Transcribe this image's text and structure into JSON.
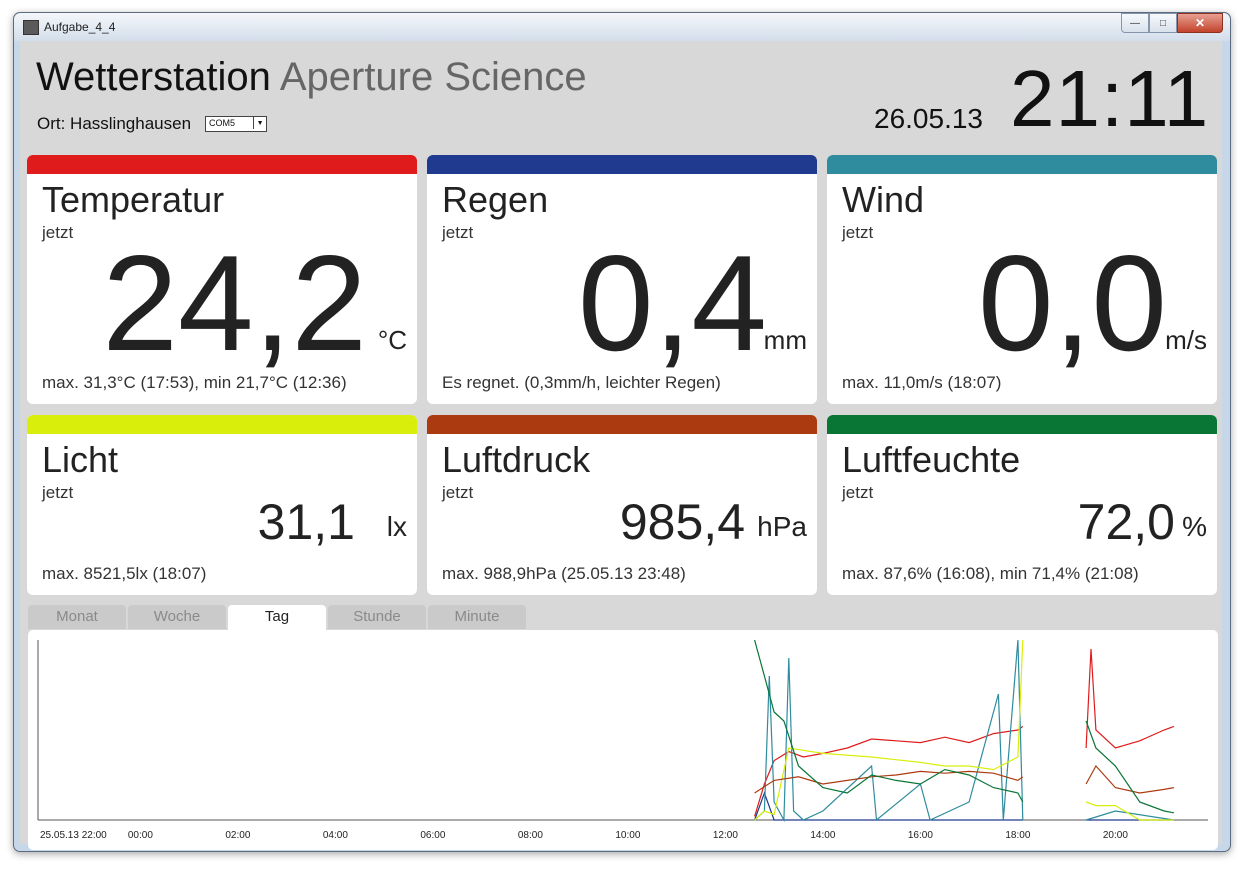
{
  "window": {
    "title": "Aufgabe_4_4"
  },
  "header": {
    "title": "Wetterstation",
    "subtitle": "Aperture Science",
    "location": "Ort: Hasslinghausen",
    "port": "COM5",
    "date": "26.05.13",
    "time": "21:11"
  },
  "cards": [
    {
      "title": "Temperatur",
      "now": "jetzt",
      "value": "24,2",
      "unit": "°C",
      "stats": "max. 31,3°C (17:53), min 21,7°C (12:36)",
      "color": "#e01b1b"
    },
    {
      "title": "Regen",
      "now": "jetzt",
      "value": "0,4",
      "unit": "mm",
      "stats": "Es regnet. (0,3mm/h, leichter Regen)",
      "color": "#1f3a8e"
    },
    {
      "title": "Wind",
      "now": "jetzt",
      "value": "0,0",
      "unit": "m/s",
      "stats": "max. 11,0m/s (18:07)",
      "color": "#2e8c9e"
    },
    {
      "title": "Licht",
      "now": "jetzt",
      "value": "31,1",
      "unit": "lx",
      "stats": "max. 8521,5lx (18:07)",
      "color": "#d9ef0b"
    },
    {
      "title": "Luftdruck",
      "now": "jetzt",
      "value": "985,4",
      "unit": "hPa",
      "stats": "max. 988,9hPa (25.05.13 23:48)",
      "color": "#ac3a10"
    },
    {
      "title": "Luftfeuchte",
      "now": "jetzt",
      "value": "72,0",
      "unit": "%",
      "stats": "max. 87,6% (16:08), min 71,4% (21:08)",
      "color": "#097636"
    }
  ],
  "tabs": [
    {
      "label": "Monat",
      "active": false
    },
    {
      "label": "Woche",
      "active": false
    },
    {
      "label": "Tag",
      "active": true
    },
    {
      "label": "Stunde",
      "active": false
    },
    {
      "label": "Minute",
      "active": false
    }
  ],
  "chart_data": {
    "type": "line",
    "x_ticks": [
      "25.05.13 22:00",
      "00:00",
      "02:00",
      "04:00",
      "06:00",
      "08:00",
      "10:00",
      "12:00",
      "14:00",
      "16:00",
      "18:00",
      "20:00"
    ],
    "x_range_hours": [
      -2.1,
      21.9
    ],
    "y_range": [
      0,
      100
    ],
    "gaps": [
      [
        18.15,
        19.4
      ]
    ],
    "series": [
      {
        "color": "#e01b1b",
        "points": [
          [
            12.6,
            2
          ],
          [
            12.8,
            20
          ],
          [
            13.0,
            33
          ],
          [
            13.3,
            38
          ],
          [
            13.6,
            35
          ],
          [
            14.0,
            37
          ],
          [
            14.5,
            40
          ],
          [
            15.0,
            45
          ],
          [
            15.5,
            44
          ],
          [
            16.0,
            43
          ],
          [
            16.5,
            46
          ],
          [
            17.0,
            43
          ],
          [
            17.5,
            48
          ],
          [
            18.0,
            50
          ],
          [
            18.1,
            52
          ],
          [
            19.4,
            40
          ],
          [
            19.5,
            95
          ],
          [
            19.6,
            50
          ],
          [
            20.0,
            40
          ],
          [
            20.5,
            44
          ],
          [
            21.0,
            50
          ],
          [
            21.2,
            52
          ]
        ]
      },
      {
        "color": "#1f3a8e",
        "points": [
          [
            12.6,
            0
          ],
          [
            12.8,
            15
          ],
          [
            13.0,
            0
          ],
          [
            13.5,
            0
          ],
          [
            14.0,
            0
          ],
          [
            14.5,
            0
          ],
          [
            15.0,
            0
          ],
          [
            15.5,
            0
          ],
          [
            16.0,
            0
          ],
          [
            16.5,
            0
          ],
          [
            17.0,
            0
          ],
          [
            17.5,
            0
          ],
          [
            18.0,
            0
          ],
          [
            18.1,
            0
          ],
          [
            19.4,
            0
          ],
          [
            20.0,
            0
          ],
          [
            21.2,
            0
          ]
        ]
      },
      {
        "color": "#2e8c9e",
        "points": [
          [
            12.6,
            0
          ],
          [
            12.8,
            5
          ],
          [
            12.9,
            80
          ],
          [
            13.0,
            10
          ],
          [
            13.2,
            0
          ],
          [
            13.3,
            90
          ],
          [
            13.4,
            5
          ],
          [
            13.6,
            0
          ],
          [
            14.0,
            5
          ],
          [
            15.0,
            30
          ],
          [
            15.1,
            0
          ],
          [
            16.0,
            20
          ],
          [
            16.2,
            0
          ],
          [
            17.0,
            10
          ],
          [
            17.6,
            70
          ],
          [
            17.7,
            0
          ],
          [
            18.0,
            100
          ],
          [
            18.1,
            0
          ],
          [
            19.4,
            0
          ],
          [
            20.0,
            5
          ],
          [
            21.2,
            0
          ]
        ]
      },
      {
        "color": "#d9ef0b",
        "points": [
          [
            12.6,
            0
          ],
          [
            12.8,
            5
          ],
          [
            13.0,
            3
          ],
          [
            13.3,
            40
          ],
          [
            14.0,
            37
          ],
          [
            15.0,
            35
          ],
          [
            16.0,
            32
          ],
          [
            16.5,
            30
          ],
          [
            17.0,
            30
          ],
          [
            17.5,
            28
          ],
          [
            18.0,
            35
          ],
          [
            18.1,
            100
          ],
          [
            19.4,
            10
          ],
          [
            19.6,
            8
          ],
          [
            20.0,
            8
          ],
          [
            20.5,
            0
          ],
          [
            21.2,
            0
          ]
        ]
      },
      {
        "color": "#ac3a10",
        "points": [
          [
            12.6,
            15
          ],
          [
            13.0,
            22
          ],
          [
            13.5,
            24
          ],
          [
            14.0,
            20
          ],
          [
            14.5,
            22
          ],
          [
            15.0,
            24
          ],
          [
            15.5,
            25
          ],
          [
            16.0,
            27
          ],
          [
            16.5,
            26
          ],
          [
            17.0,
            27
          ],
          [
            17.5,
            26
          ],
          [
            18.0,
            22
          ],
          [
            18.1,
            24
          ],
          [
            19.4,
            20
          ],
          [
            19.6,
            30
          ],
          [
            20.0,
            18
          ],
          [
            20.5,
            15
          ],
          [
            21.0,
            17
          ],
          [
            21.2,
            18
          ]
        ]
      },
      {
        "color": "#097636",
        "points": [
          [
            12.6,
            100
          ],
          [
            12.8,
            80
          ],
          [
            13.0,
            60
          ],
          [
            13.2,
            55
          ],
          [
            13.5,
            30
          ],
          [
            14.0,
            18
          ],
          [
            14.5,
            15
          ],
          [
            15.0,
            25
          ],
          [
            15.5,
            22
          ],
          [
            16.0,
            20
          ],
          [
            16.5,
            28
          ],
          [
            17.0,
            25
          ],
          [
            17.5,
            18
          ],
          [
            18.0,
            15
          ],
          [
            18.1,
            10
          ],
          [
            19.4,
            55
          ],
          [
            19.6,
            40
          ],
          [
            20.0,
            30
          ],
          [
            20.5,
            10
          ],
          [
            21.0,
            5
          ],
          [
            21.2,
            4
          ]
        ]
      }
    ]
  }
}
